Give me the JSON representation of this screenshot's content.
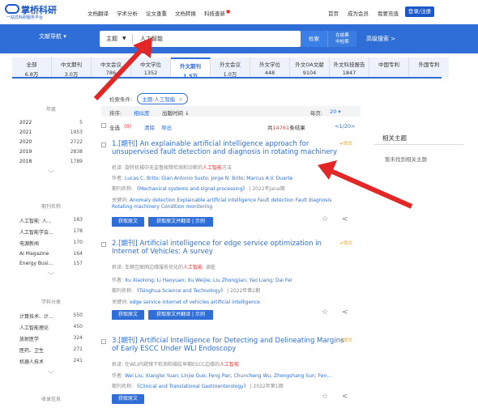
{
  "header": {
    "logo_name": "掌桥科研",
    "logo_slogan": "一站式科研服务平台",
    "nav": [
      "文档翻译",
      "学术分析",
      "论文查重",
      "文档转换",
      "科技查新"
    ],
    "links": [
      "首页",
      "成为会员",
      "我要充值"
    ],
    "login": "登录/注册"
  },
  "search": {
    "doc_nav": "文献导航 ▾",
    "field": "主题",
    "query": "人工智能",
    "btn": "检索",
    "btn2_line1": "在结果",
    "btn2_line2": "中检索",
    "advanced": "高级搜索 >"
  },
  "tabs": [
    {
      "label": "全部",
      "count": "6.8万"
    },
    {
      "label": "中文期刊",
      "count": "3.0万"
    },
    {
      "label": "中文会议",
      "count": "786"
    },
    {
      "label": "中文学位",
      "count": "1352"
    },
    {
      "label": "外文期刊",
      "count": "1.5万"
    },
    {
      "label": "外文会议",
      "count": "1.0万"
    },
    {
      "label": "外文学位",
      "count": "448"
    },
    {
      "label": "外文OA文献",
      "count": "9104"
    },
    {
      "label": "外文科技报告",
      "count": "1847"
    },
    {
      "label": "中国专利",
      "count": ""
    },
    {
      "label": "外国专利",
      "count": ""
    }
  ],
  "sidebar": {
    "year": {
      "title": "年度",
      "items": [
        {
          "label": "2022",
          "count": "5"
        },
        {
          "label": "2021",
          "count": "1953"
        },
        {
          "label": "2020",
          "count": "2722"
        },
        {
          "label": "2019",
          "count": "2838"
        },
        {
          "label": "2018",
          "count": "1789"
        }
      ]
    },
    "journal": {
      "title": "期刊名称",
      "items": [
        {
          "label": "人工智能: 人...",
          "count": "183"
        },
        {
          "label": "人工智能学会...",
          "count": "178"
        },
        {
          "label": "电源新闻",
          "count": "170"
        },
        {
          "label": "AI Magazine",
          "count": "164"
        },
        {
          "label": "Energy Busi...",
          "count": "157"
        }
      ]
    },
    "subject": {
      "title": "学科分类",
      "items": [
        {
          "label": "计算技术、计...",
          "count": "550"
        },
        {
          "label": "人工智能理论",
          "count": "450"
        },
        {
          "label": "放射医学",
          "count": "324"
        },
        {
          "label": "医药、卫生",
          "count": "271"
        },
        {
          "label": "机器人技术",
          "count": "241"
        }
      ]
    },
    "collection": {
      "title": "收录信息"
    }
  },
  "conditions": {
    "label": "检索条件:",
    "tag": "主题:人工智能",
    "tag_x": "×"
  },
  "sortbar": {
    "label": "排序:",
    "relevance": "相似度",
    "time": "出版时间 ↓",
    "per_page_label": "每页:",
    "per_page": "20 ▾"
  },
  "listbar": {
    "select_all": "全选",
    "selected": "(0)",
    "clear": "清除",
    "export": "导出",
    "total_prefix": "共",
    "total": "14761",
    "total_suffix": "条结果",
    "pager": "<1/20>"
  },
  "results": [
    {
      "title": "1.[期刊] An explainable artificial intelligence approach for unsupervised fault detection and diagnosis in rotating machinery",
      "badge": "原文",
      "trans_label": "机译:",
      "trans_pre": "旋转机械中无监督故障检测和诊断的",
      "trans_hl": "人工智能",
      "trans_post": "方法",
      "authors_label": "作者:",
      "authors": "Lucas C. Brito; Gian Antonio Susto; Jorge N. Brito; Marcus A.V. Duarte",
      "journal_label": "期刊名称:",
      "journal": "《Mechanical systems and signal processing》",
      "issue": " | 2022年Jana期",
      "kw_label": "关键词:",
      "keywords_line1": "Anomaly detection   Explainable artificial intelligence   Fault detection   Fault diagnosis",
      "keywords_line2": "Rotating machinery   Condition monitoring",
      "btn1": "获取原文",
      "btn2": "获取原文并翻译 | 示例"
    },
    {
      "title": "2.[期刊] Artificial intelligence for edge service optimization in Internet of Vehicles: A survey",
      "badge": "原文",
      "trans_label": "机译:",
      "trans_pre": "车辆互联网边缘服务优化的",
      "trans_hl": "人工智能",
      "trans_post": ": 调查",
      "authors_label": "作者:",
      "authors": "Xu Xiaolong; Li Haoyuan; Xu Weijie; Liu Zhongjian; Yao Liang; Dai Fei",
      "journal_label": "期刊名称:",
      "journal": "《Tsinghua Science and Technology》",
      "issue": " | 2022年第2期",
      "kw_label": "关键词:",
      "keywords_line1": "edge service   internet of vehicles   artificial intelligence",
      "btn1": "获取原文",
      "btn2": "获取原文并翻译 | 示例"
    },
    {
      "title": "3.[期刊] Artificial Intelligence for Detecting and Delineating Margins of Early ESCC Under WLI Endoscopy",
      "badge": "原文",
      "trans_label": "机译:",
      "trans_pre": "在WLI内窥镜下检测和描绘早期ESCC边缘的",
      "trans_hl": "人工智能",
      "trans_post": "",
      "authors_label": "作者:",
      "authors": "Wei Liu; Xianglei Yuan; Linjie Guo; Feng Pan; Chuncheng Wu; Zhongshang Sun; Fen...",
      "journal_label": "期刊名称:",
      "journal": "《Clinical and Translational Gastroenterology》",
      "issue": " | 2022年第1期",
      "btn1": "获取原文"
    }
  ],
  "right": {
    "title": "相关主题",
    "empty": "暂未找到相关主题"
  },
  "colors": {
    "brand": "#2f6ed6",
    "highlight": "#e33333",
    "badge": "#e7a12a"
  }
}
